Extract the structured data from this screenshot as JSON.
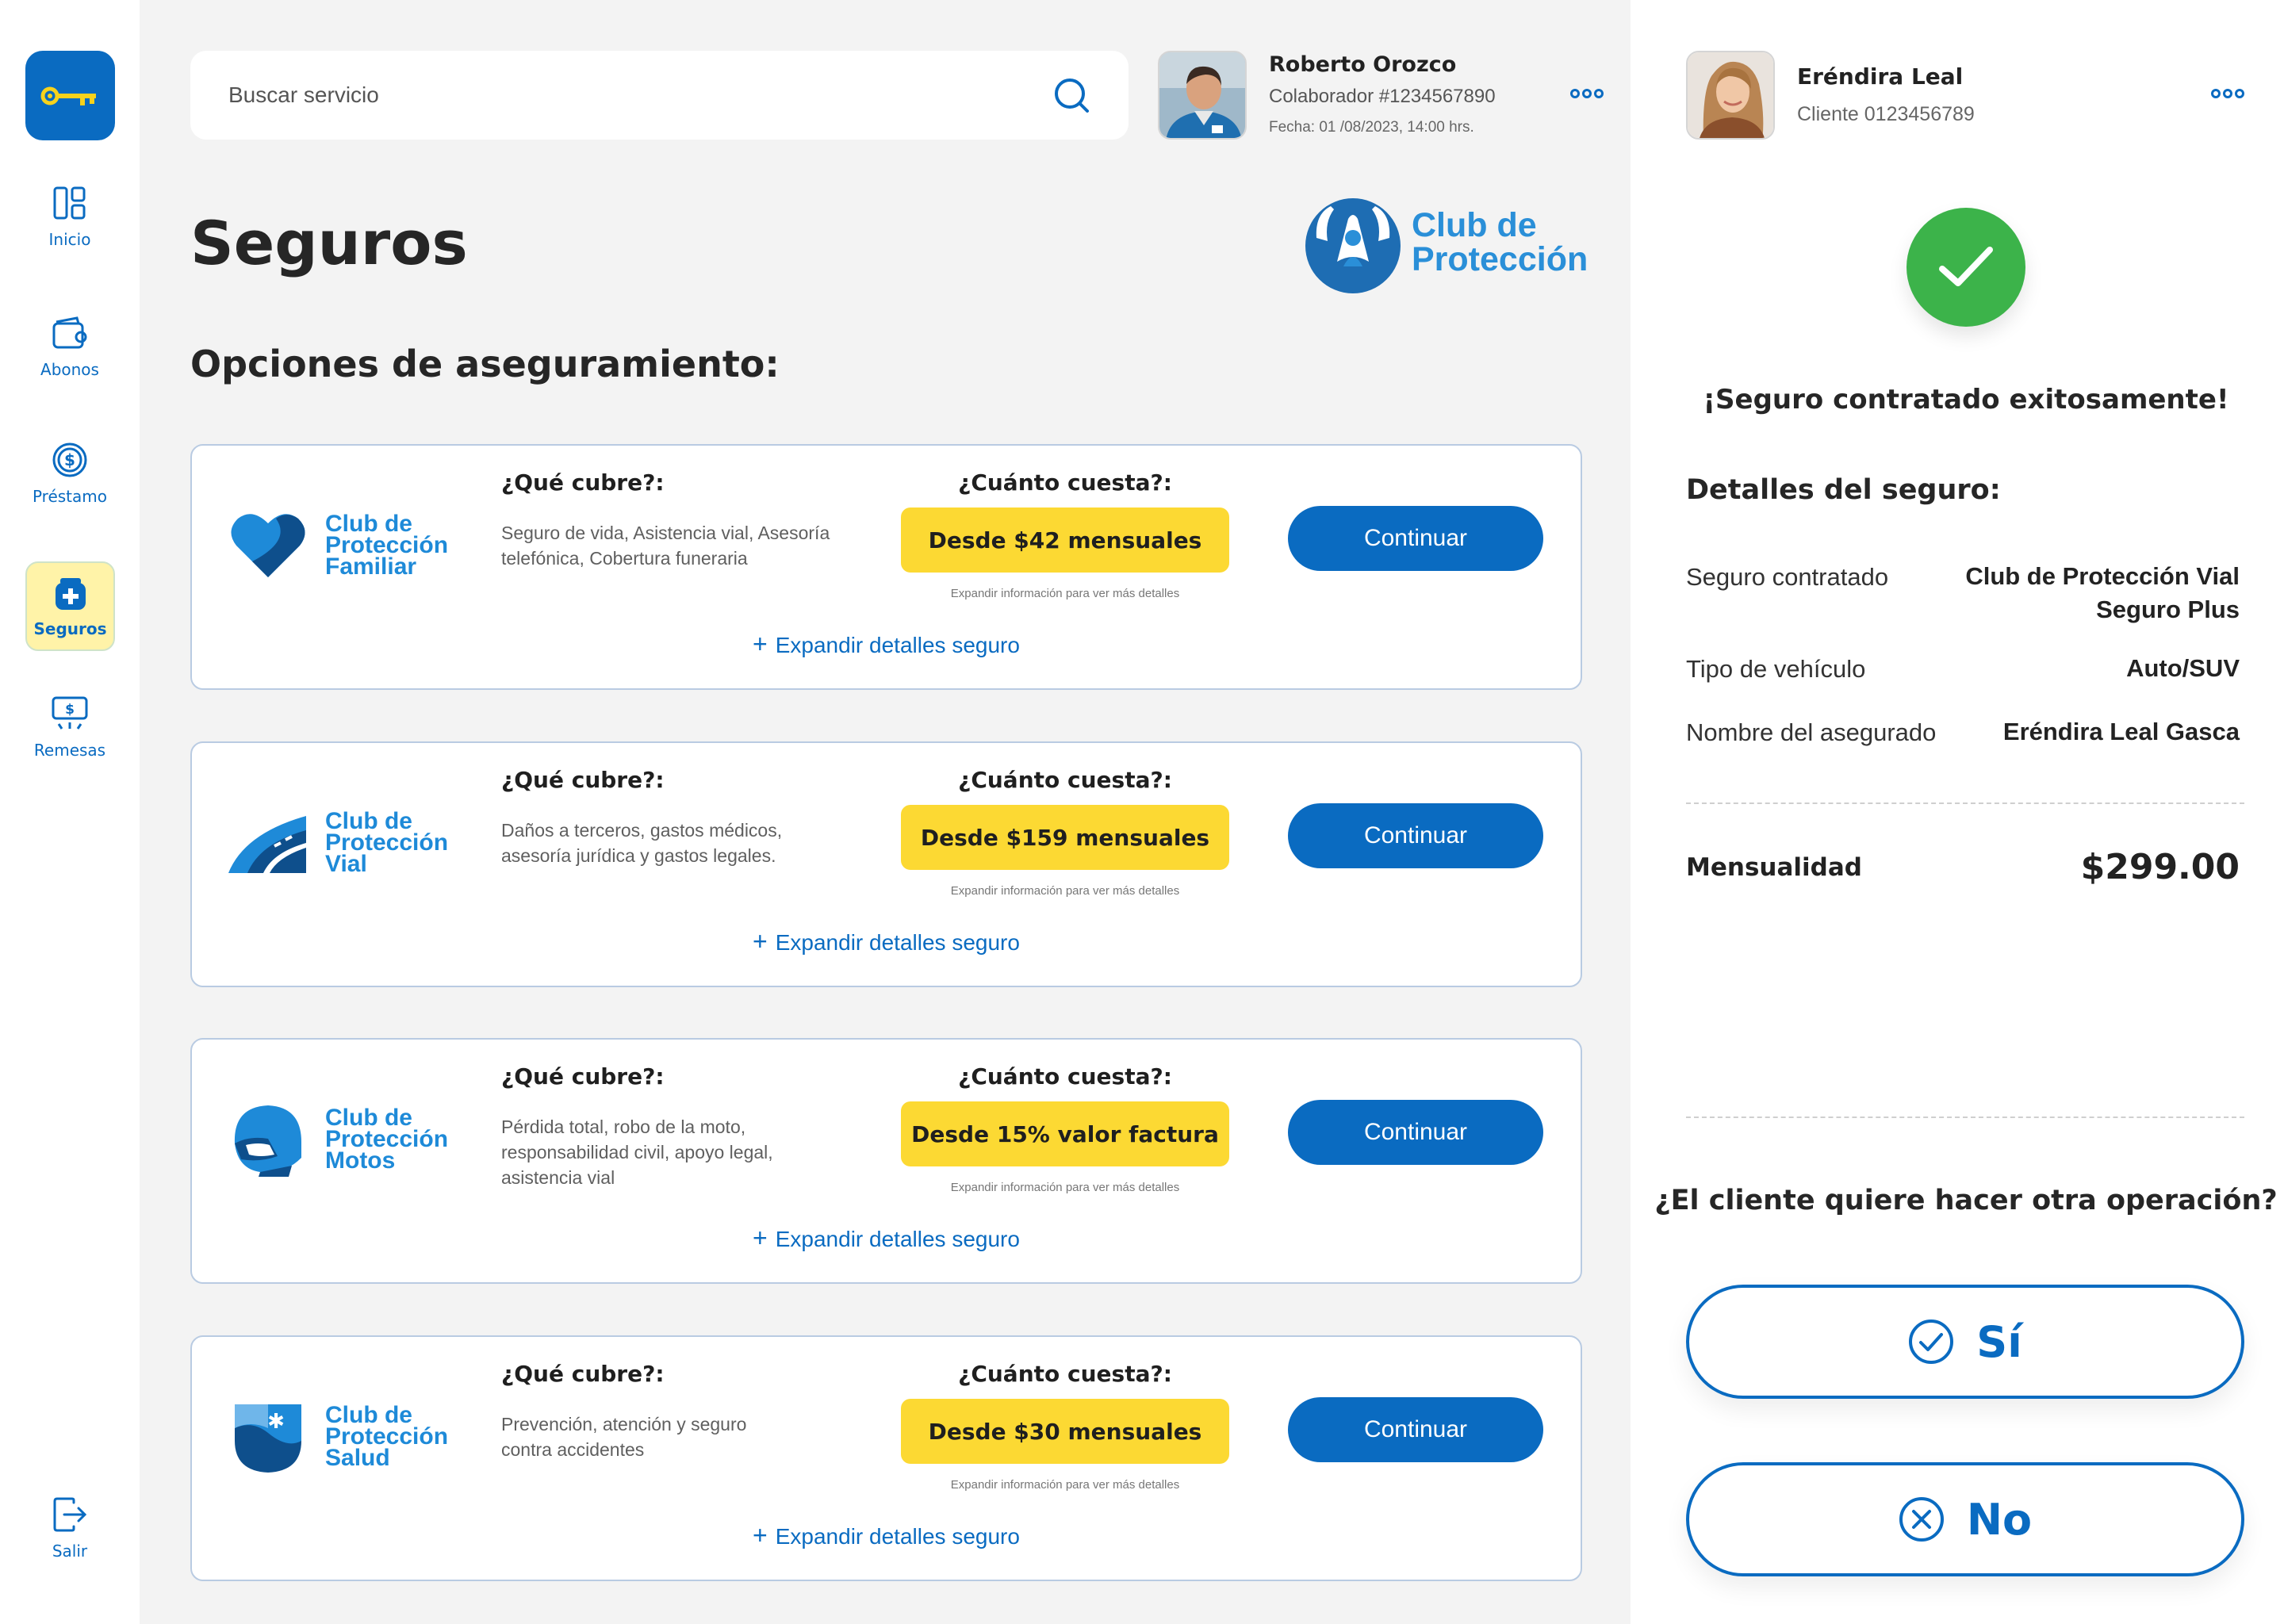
{
  "sidebar": {
    "items": [
      {
        "label": "Inicio",
        "icon": "dashboard-icon"
      },
      {
        "label": "Abonos",
        "icon": "wallet-icon"
      },
      {
        "label": "Préstamo",
        "icon": "dollar-coin-icon"
      },
      {
        "label": "Seguros",
        "icon": "insurance-icon",
        "active": true
      },
      {
        "label": "Remesas",
        "icon": "remittance-icon"
      }
    ],
    "logout_label": "Salir"
  },
  "search": {
    "placeholder": "Buscar servicio"
  },
  "user": {
    "name": "Roberto Orozco",
    "role": "Colaborador #1234567890",
    "date": "Fecha: 01 /08/2023, 14:00 hrs."
  },
  "page": {
    "title": "Seguros",
    "brand": "Club de Protección",
    "section_title": "Opciones de aseguramiento:"
  },
  "cards": [
    {
      "logo_lines": [
        "Club de",
        "Protección",
        "Familiar"
      ],
      "q_cover": "¿Qué cubre?:",
      "cover": "Seguro de vida, Asistencia vial, Asesoría telefónica, Cobertura funeraria",
      "q_cost": "¿Cuánto cuesta?:",
      "price": "Desde $42 mensuales",
      "note": "Expandir información para ver más detalles",
      "cta": "Continuar",
      "expand": "Expandir detalles seguro"
    },
    {
      "logo_lines": [
        "Club de",
        "Protección",
        "Vial"
      ],
      "q_cover": "¿Qué cubre?:",
      "cover": "Daños a terceros, gastos médicos, asesoría jurídica y gastos legales.",
      "q_cost": "¿Cuánto cuesta?:",
      "price": "Desde $159 mensuales",
      "note": "Expandir información para ver más detalles",
      "cta": "Continuar",
      "expand": "Expandir detalles seguro"
    },
    {
      "logo_lines": [
        "Club de",
        "Protección",
        "Motos"
      ],
      "q_cover": "¿Qué cubre?:",
      "cover": "Pérdida total, robo de la moto, responsabilidad civil, apoyo legal, asistencia vial",
      "q_cost": "¿Cuánto cuesta?:",
      "price": "Desde 15% valor factura",
      "note": "Expandir información para ver más detalles",
      "cta": "Continuar",
      "expand": "Expandir detalles seguro"
    },
    {
      "logo_lines": [
        "Club de",
        "Protección",
        "Salud"
      ],
      "q_cover": "¿Qué cubre?:",
      "cover": "Prevención, atención y seguro contra accidentes",
      "q_cost": "¿Cuánto cuesta?:",
      "price": "Desde $30 mensuales",
      "note": "Expandir información para ver más detalles",
      "cta": "Continuar",
      "expand": "Expandir detalles seguro"
    }
  ],
  "client": {
    "name": "Eréndira Leal",
    "id": "Cliente 0123456789"
  },
  "confirmation": {
    "message": "¡Seguro contratado exitosamente!",
    "details_title": "Detalles del seguro:",
    "rows": [
      {
        "label": "Seguro contratado",
        "value_lines": [
          "Club de Protección Vial",
          "Seguro Plus"
        ]
      },
      {
        "label": "Tipo de vehículo",
        "value_lines": [
          "Auto/SUV"
        ]
      },
      {
        "label": "Nombre del asegurado",
        "value_lines": [
          "Eréndira Leal Gasca"
        ]
      }
    ],
    "monthly_label": "Mensualidad",
    "monthly_value": "$299.00",
    "question": "¿El cliente quiere hacer otra operación?",
    "yes": "Sí",
    "no": "No"
  },
  "colors": {
    "primary": "#0a6bc1",
    "price_badge": "#fcd933",
    "success": "#3cb34a",
    "active_nav": "#fff3a8",
    "main_bg": "#f3f3f3"
  }
}
